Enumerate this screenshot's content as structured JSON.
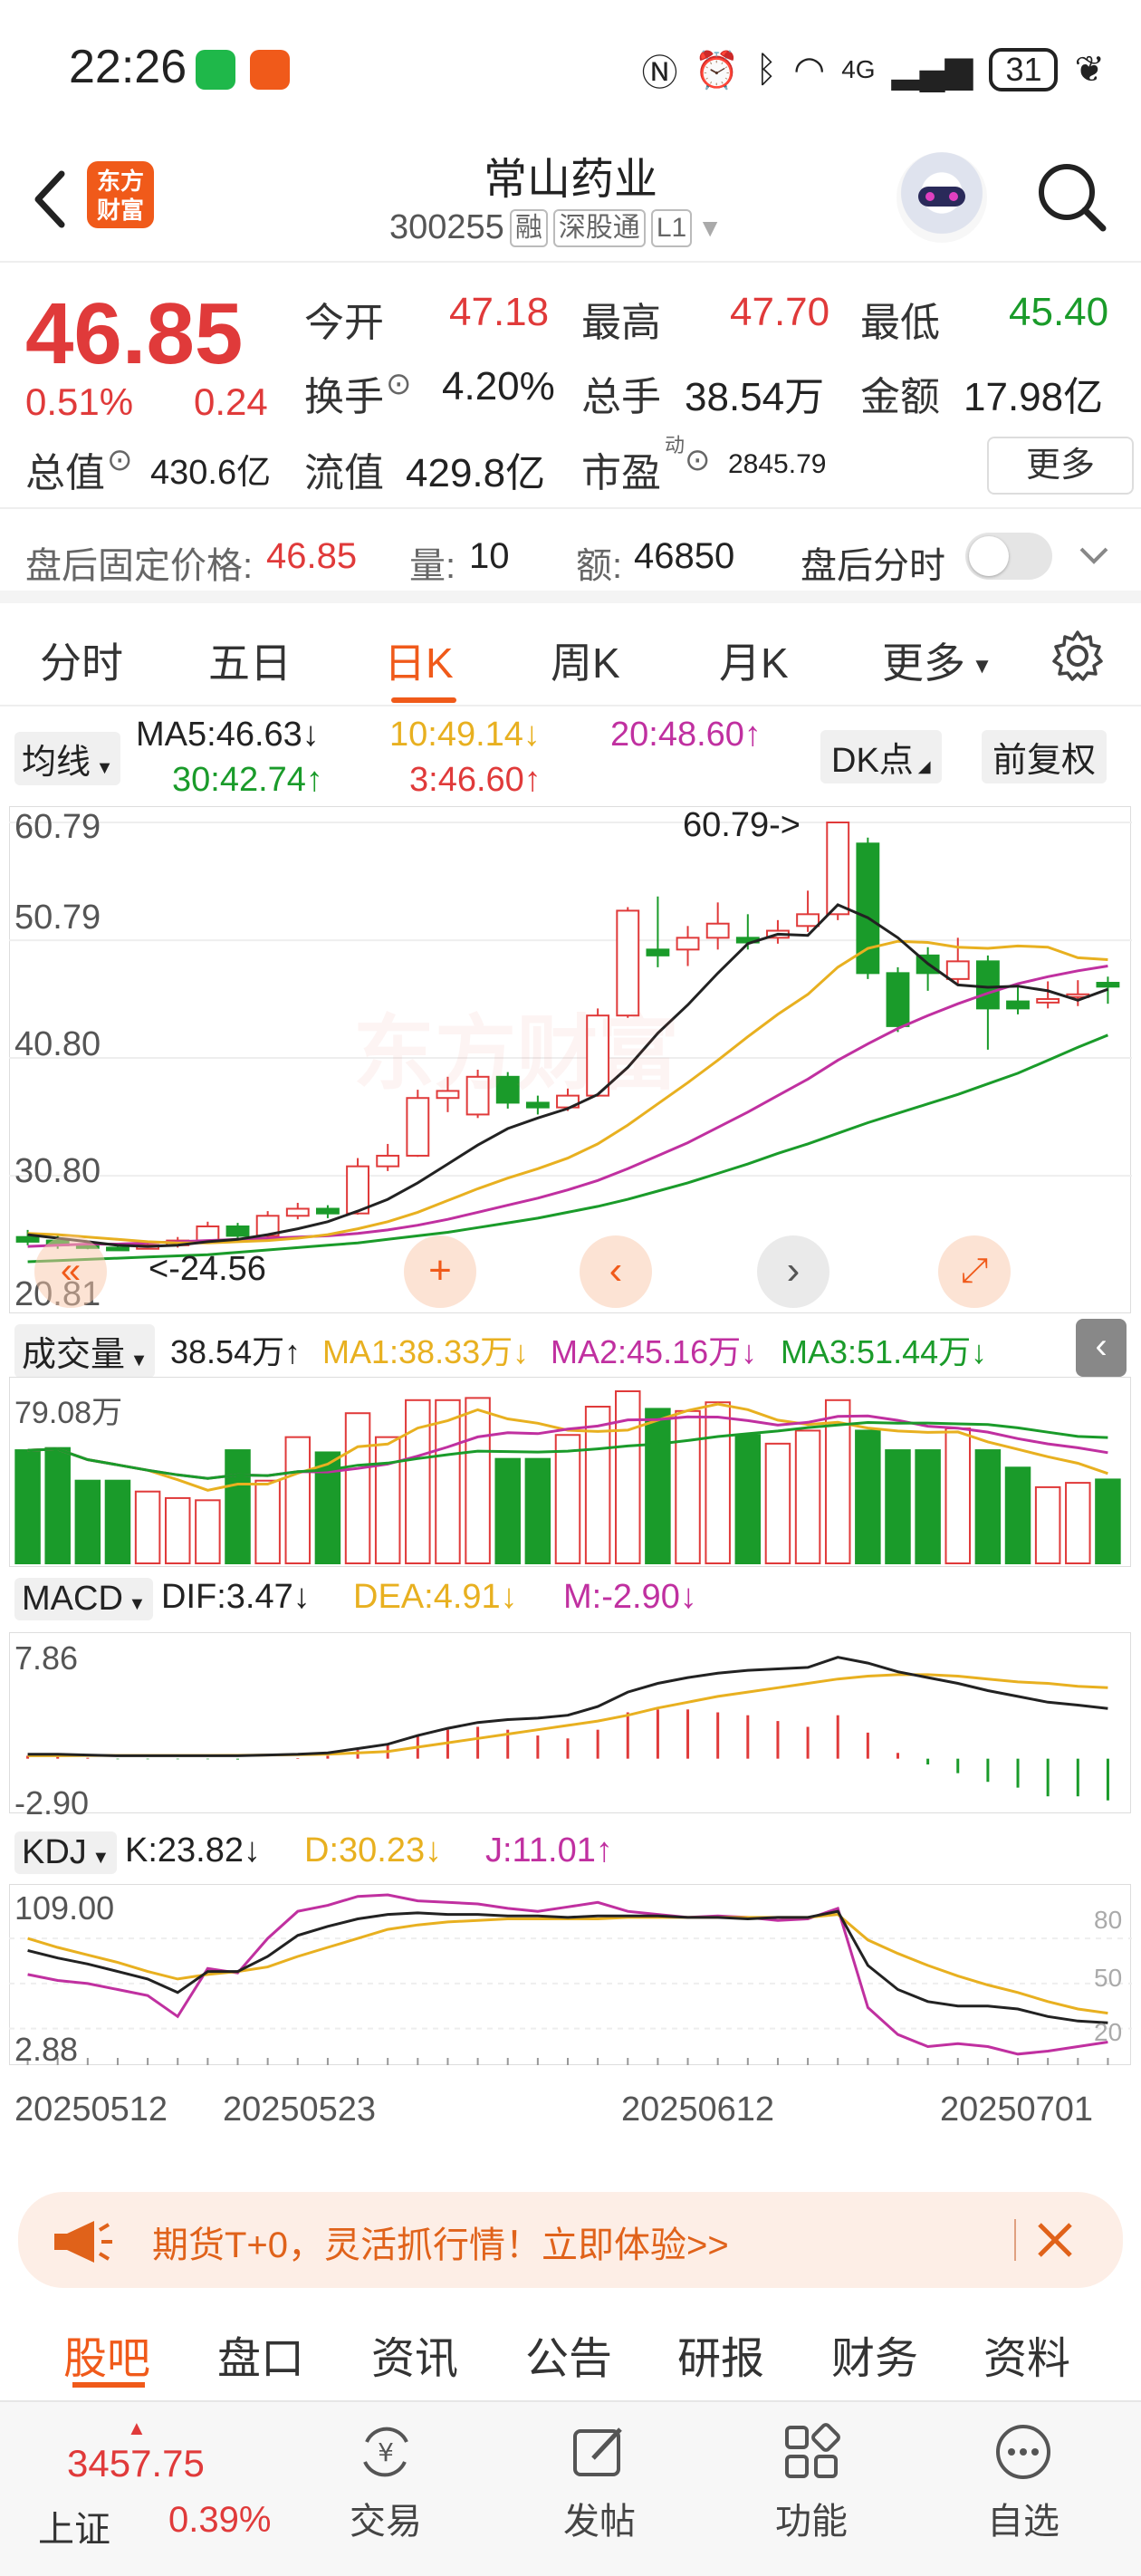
{
  "status_bar": {
    "time": "22:26",
    "signal": "4G",
    "battery": "31"
  },
  "header": {
    "logo_text": "东方财富",
    "stock_name": "常山药业",
    "stock_code": "300255",
    "tags": [
      "融",
      "深股通",
      "L1"
    ]
  },
  "quote": {
    "price": "46.85",
    "change_pct": "0.51%",
    "change": "0.24",
    "fields": [
      {
        "label": "今开",
        "value": "47.18",
        "color": "red"
      },
      {
        "label": "最高",
        "value": "47.70",
        "color": "red"
      },
      {
        "label": "最低",
        "value": "45.40",
        "color": "green"
      },
      {
        "label": "换手",
        "value": "4.20%",
        "color": "dark"
      },
      {
        "label": "总手",
        "value": "38.54万",
        "color": "dark"
      },
      {
        "label": "金额",
        "value": "17.98亿",
        "color": "dark"
      },
      {
        "label": "总值",
        "value": "430.6亿",
        "color": "dark"
      },
      {
        "label": "流值",
        "value": "429.8亿",
        "color": "dark"
      },
      {
        "label": "市盈",
        "value": "2845.79",
        "color": "dark"
      }
    ],
    "pe_superscript": "动",
    "more_label": "更多"
  },
  "after_hours": {
    "price_label": "盘后固定价格:",
    "price_value": "46.85",
    "vol_label": "量:",
    "vol_value": "10",
    "amt_label": "额:",
    "amt_value": "46850",
    "timeshare_label": "盘后分时"
  },
  "period_tabs": [
    "分时",
    "五日",
    "日K",
    "周K",
    "月K",
    "更多"
  ],
  "active_period": "日K",
  "ma_legend": {
    "selector": "均线",
    "ma5": "MA5:46.63↓",
    "ma10": "10:49.14↓",
    "ma20": "20:48.60↑",
    "ma30": "30:42.74↑",
    "ma3": "3:46.60↑",
    "dk_label": "DK点",
    "adjust_label": "前复权"
  },
  "price_axis": [
    "60.79",
    "50.79",
    "40.80",
    "30.80",
    "20.81"
  ],
  "price_annotations": {
    "high": "60.79->",
    "low": "<-24.56"
  },
  "volume_legend": {
    "selector": "成交量",
    "vol": "38.54万↑",
    "ma1": "MA1:38.33万↓",
    "ma2": "MA2:45.16万↓",
    "ma3": "MA3:51.44万↓",
    "axis_top": "79.08万"
  },
  "macd_legend": {
    "selector": "MACD",
    "dif": "DIF:3.47↓",
    "dea": "DEA:4.91↓",
    "m": "M:-2.90↓",
    "axis_top": "7.86",
    "axis_bottom": "-2.90"
  },
  "kdj_legend": {
    "selector": "KDJ",
    "k": "K:23.82↓",
    "d": "D:30.23↓",
    "j": "J:11.01↑",
    "axis_top": "109.00",
    "axis_bottom": "2.88",
    "right_ticks": [
      "80",
      "50",
      "20"
    ]
  },
  "date_axis": [
    "20250512",
    "20250523",
    "20250612",
    "20250701"
  ],
  "watermark": "东方财富",
  "colors": {
    "up": "#e03a3a",
    "down": "#1a9b2a",
    "ma5": "#222222",
    "ma10": "#e8b020",
    "ma20": "#c030a0",
    "ma30": "#1a9b2a",
    "accent": "#f05a1a"
  },
  "chart_data": {
    "type": "candlestick",
    "candles": [
      {
        "o": 25.6,
        "c": 25.2,
        "h": 26.2,
        "l": 24.9
      },
      {
        "o": 25.3,
        "c": 24.9,
        "h": 25.7,
        "l": 24.6
      },
      {
        "o": 24.9,
        "c": 24.7,
        "h": 25.3,
        "l": 24.56
      },
      {
        "o": 24.7,
        "c": 24.6,
        "h": 25.1,
        "l": 24.56
      },
      {
        "o": 24.6,
        "c": 24.9,
        "h": 25.2,
        "l": 24.56
      },
      {
        "o": 24.9,
        "c": 25.3,
        "h": 25.6,
        "l": 24.7
      },
      {
        "o": 25.3,
        "c": 26.5,
        "h": 26.9,
        "l": 25.1
      },
      {
        "o": 26.5,
        "c": 25.7,
        "h": 26.8,
        "l": 25.5
      },
      {
        "o": 25.7,
        "c": 27.4,
        "h": 27.8,
        "l": 25.6
      },
      {
        "o": 27.4,
        "c": 28.0,
        "h": 28.5,
        "l": 27.1
      },
      {
        "o": 28.0,
        "c": 27.6,
        "h": 28.3,
        "l": 27.2
      },
      {
        "o": 27.6,
        "c": 31.6,
        "h": 32.3,
        "l": 27.5
      },
      {
        "o": 31.6,
        "c": 32.5,
        "h": 33.5,
        "l": 31.2
      },
      {
        "o": 32.5,
        "c": 37.4,
        "h": 38.1,
        "l": 32.4
      },
      {
        "o": 37.4,
        "c": 38.0,
        "h": 39.2,
        "l": 36.2
      },
      {
        "o": 36.0,
        "c": 39.2,
        "h": 39.8,
        "l": 35.7
      },
      {
        "o": 39.2,
        "c": 37.0,
        "h": 39.6,
        "l": 36.5
      },
      {
        "o": 37.0,
        "c": 36.6,
        "h": 37.6,
        "l": 36.0
      },
      {
        "o": 36.6,
        "c": 37.6,
        "h": 38.2,
        "l": 36.3
      },
      {
        "o": 37.6,
        "c": 44.4,
        "h": 45.0,
        "l": 37.5
      },
      {
        "o": 44.4,
        "c": 53.3,
        "h": 53.6,
        "l": 44.2
      },
      {
        "o": 50.0,
        "c": 49.5,
        "h": 54.5,
        "l": 48.5
      },
      {
        "o": 50.0,
        "c": 51.0,
        "h": 52.0,
        "l": 48.6
      },
      {
        "o": 51.0,
        "c": 52.2,
        "h": 54.0,
        "l": 50.0
      },
      {
        "o": 51.0,
        "c": 50.6,
        "h": 53.0,
        "l": 50.0
      },
      {
        "o": 51.0,
        "c": 51.6,
        "h": 52.5,
        "l": 50.5
      },
      {
        "o": 52.0,
        "c": 53.0,
        "h": 55.0,
        "l": 51.5
      },
      {
        "o": 53.0,
        "c": 60.79,
        "h": 60.79,
        "l": 52.5
      },
      {
        "o": 59.0,
        "c": 48.0,
        "h": 59.5,
        "l": 47.5
      },
      {
        "o": 48.0,
        "c": 43.5,
        "h": 48.5,
        "l": 43.0
      },
      {
        "o": 49.5,
        "c": 48.0,
        "h": 50.2,
        "l": 46.5
      },
      {
        "o": 47.5,
        "c": 49.0,
        "h": 51.0,
        "l": 47.0
      },
      {
        "o": 49.0,
        "c": 45.0,
        "h": 49.5,
        "l": 41.5
      },
      {
        "o": 45.6,
        "c": 45.0,
        "h": 47.0,
        "l": 44.5
      },
      {
        "o": 45.5,
        "c": 45.8,
        "h": 47.3,
        "l": 45.0
      },
      {
        "o": 46.0,
        "c": 46.2,
        "h": 47.4,
        "l": 45.2
      },
      {
        "o": 47.18,
        "c": 46.85,
        "h": 47.7,
        "l": 45.4
      }
    ],
    "ma5": [
      25.8,
      25.5,
      25.2,
      24.9,
      24.8,
      24.9,
      25.2,
      25.4,
      25.8,
      26.3,
      26.9,
      27.8,
      28.8,
      30.2,
      31.8,
      33.4,
      34.8,
      35.7,
      36.5,
      37.7,
      40.0,
      42.9,
      45.3,
      48.0,
      50.5,
      51.3,
      51.2,
      53.8,
      52.7,
      51.0,
      48.8,
      47.0,
      46.8,
      46.9,
      46.5,
      45.7,
      46.63
    ],
    "ma10": [
      25.9,
      25.8,
      25.6,
      25.4,
      25.2,
      25.1,
      25.1,
      25.2,
      25.3,
      25.5,
      25.8,
      26.3,
      26.9,
      27.7,
      28.7,
      29.7,
      30.6,
      31.4,
      32.3,
      33.5,
      35.1,
      36.9,
      38.7,
      40.6,
      42.6,
      44.5,
      46.2,
      48.5,
      50.1,
      50.7,
      50.6,
      50.2,
      50.1,
      50.3,
      50.2,
      49.3,
      49.14
    ],
    "ma20": [
      24.8,
      24.9,
      25.0,
      25.0,
      25.1,
      25.2,
      25.3,
      25.4,
      25.5,
      25.6,
      25.7,
      25.9,
      26.2,
      26.6,
      27.1,
      27.7,
      28.3,
      28.9,
      29.6,
      30.4,
      31.4,
      32.5,
      33.6,
      34.9,
      36.2,
      37.6,
      39.0,
      40.6,
      42.0,
      43.3,
      44.4,
      45.4,
      46.3,
      47.1,
      47.7,
      48.2,
      48.6
    ],
    "ma30": [
      23.5,
      23.6,
      23.7,
      23.8,
      23.9,
      24.0,
      24.1,
      24.3,
      24.5,
      24.7,
      24.9,
      25.1,
      25.4,
      25.7,
      26.0,
      26.4,
      26.8,
      27.2,
      27.7,
      28.2,
      28.8,
      29.5,
      30.2,
      31.0,
      31.8,
      32.7,
      33.5,
      34.4,
      35.3,
      36.1,
      36.9,
      37.7,
      38.6,
      39.5,
      40.6,
      41.7,
      42.74
    ],
    "volume_wan": [
      52,
      53,
      38,
      38,
      33,
      30,
      29,
      52,
      38,
      58,
      51,
      69,
      58,
      75,
      75,
      76,
      48,
      48,
      59,
      72,
      79.08,
      71,
      70,
      74,
      59,
      55,
      61,
      75,
      61,
      52,
      52,
      62,
      52,
      44,
      35,
      37,
      38.54
    ],
    "dif": [
      0.3,
      0.3,
      0.25,
      0.2,
      0.2,
      0.2,
      0.2,
      0.2,
      0.25,
      0.3,
      0.4,
      0.7,
      1.0,
      1.6,
      2.1,
      2.5,
      2.7,
      2.8,
      3.0,
      3.6,
      4.6,
      5.2,
      5.6,
      5.9,
      6.1,
      6.2,
      6.3,
      7.0,
      6.6,
      6.0,
      5.6,
      5.2,
      4.7,
      4.3,
      3.9,
      3.7,
      3.47
    ],
    "dea": [
      0.2,
      0.2,
      0.22,
      0.22,
      0.22,
      0.22,
      0.22,
      0.23,
      0.25,
      0.28,
      0.3,
      0.4,
      0.5,
      0.8,
      1.1,
      1.4,
      1.7,
      2.0,
      2.3,
      2.6,
      3.0,
      3.5,
      3.9,
      4.3,
      4.6,
      4.9,
      5.2,
      5.5,
      5.7,
      5.8,
      5.8,
      5.7,
      5.5,
      5.3,
      5.2,
      5.0,
      4.91
    ],
    "kdj_k": [
      72,
      67,
      63,
      58,
      53,
      44,
      58,
      58,
      68,
      82,
      88,
      93,
      96,
      97,
      96,
      96,
      95,
      95,
      94,
      95,
      95,
      95,
      94,
      94,
      93,
      94,
      94,
      98,
      62,
      46,
      38,
      35,
      35,
      33,
      28,
      25,
      23.82
    ],
    "kdj_d": [
      80,
      74,
      69,
      64,
      58,
      53,
      56,
      58,
      61,
      68,
      74,
      80,
      86,
      89,
      91,
      92,
      93,
      93,
      93,
      93,
      94,
      94,
      94,
      94,
      94,
      94,
      94,
      96,
      79,
      70,
      62,
      55,
      49,
      44,
      38,
      33,
      30.23
    ],
    "kdj_j": [
      56,
      52,
      50,
      46,
      42,
      28,
      60,
      57,
      80,
      98,
      102,
      108,
      109,
      105,
      104,
      103,
      100,
      98,
      101,
      104,
      98,
      96,
      94,
      95,
      94,
      92,
      93,
      100,
      34,
      16,
      8,
      10,
      8,
      3,
      5,
      8,
      11.01
    ],
    "ylim_price": [
      20.81,
      60.79
    ],
    "x": [
      "20250512",
      "20250523",
      "20250612",
      "20250701"
    ]
  },
  "banner": {
    "text": "期货T+0，灵活抓行情！立即体验>>"
  },
  "content_tabs": [
    "股吧",
    "盘口",
    "资讯",
    "公告",
    "研报",
    "财务",
    "资料"
  ],
  "active_content_tab": "股吧",
  "index_ticker": {
    "value": "3457.75",
    "name": "上证",
    "pct": "0.39%"
  },
  "bottom_nav": [
    "交易",
    "发帖",
    "功能",
    "自选"
  ]
}
